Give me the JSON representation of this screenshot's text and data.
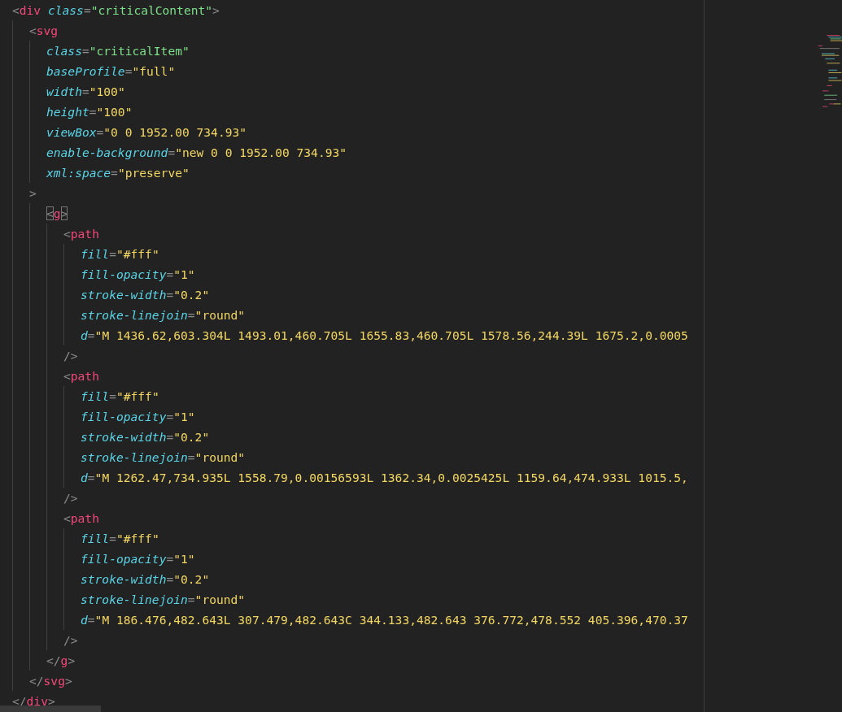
{
  "editor": {
    "lines": [
      {
        "tokens": [
          {
            "kind": "punct",
            "text": "<"
          },
          {
            "kind": "tag",
            "text": "div"
          },
          {
            "kind": "attr",
            "text": "class"
          },
          {
            "kind": "punct",
            "text": "="
          },
          {
            "kind": "class-value",
            "text": "\"criticalContent\""
          },
          {
            "kind": "punct",
            "text": ">"
          }
        ],
        "children": [
          {
            "tokens": [
              {
                "kind": "punct",
                "text": "<"
              },
              {
                "kind": "tag",
                "text": "svg"
              }
            ],
            "children": [
              {
                "tokens": [
                  {
                    "kind": "attr",
                    "text": "class"
                  },
                  {
                    "kind": "punct",
                    "text": "="
                  },
                  {
                    "kind": "class-value",
                    "text": "\"criticalItem\""
                  }
                ]
              },
              {
                "tokens": [
                  {
                    "kind": "attr",
                    "text": "baseProfile"
                  },
                  {
                    "kind": "punct",
                    "text": "="
                  },
                  {
                    "kind": "value",
                    "text": "\"full\""
                  }
                ]
              },
              {
                "tokens": [
                  {
                    "kind": "attr",
                    "text": "width"
                  },
                  {
                    "kind": "punct",
                    "text": "="
                  },
                  {
                    "kind": "value",
                    "text": "\"100\""
                  }
                ]
              },
              {
                "tokens": [
                  {
                    "kind": "attr",
                    "text": "height"
                  },
                  {
                    "kind": "punct",
                    "text": "="
                  },
                  {
                    "kind": "value",
                    "text": "\"100\""
                  }
                ]
              },
              {
                "tokens": [
                  {
                    "kind": "attr",
                    "text": "viewBox"
                  },
                  {
                    "kind": "punct",
                    "text": "="
                  },
                  {
                    "kind": "value",
                    "text": "\"0 0 1952.00 734.93\""
                  }
                ]
              },
              {
                "tokens": [
                  {
                    "kind": "attr",
                    "text": "enable-background"
                  },
                  {
                    "kind": "punct",
                    "text": "="
                  },
                  {
                    "kind": "value",
                    "text": "\"new 0 0 1952.00 734.93\""
                  }
                ]
              },
              {
                "tokens": [
                  {
                    "kind": "attr",
                    "text": "xml:space"
                  },
                  {
                    "kind": "punct",
                    "text": "="
                  },
                  {
                    "kind": "value",
                    "text": "\"preserve\""
                  }
                ]
              }
            ]
          },
          {
            "tokens": [
              {
                "kind": "punct",
                "text": ">"
              }
            ],
            "children": [
              {
                "tokens": [
                  {
                    "kind": "punct",
                    "text": "<",
                    "matched": true
                  },
                  {
                    "kind": "tag",
                    "text": "g"
                  },
                  {
                    "kind": "punct",
                    "text": ">",
                    "matched": true
                  }
                ],
                "children": [
                  {
                    "tokens": [
                      {
                        "kind": "punct",
                        "text": "<"
                      },
                      {
                        "kind": "tag",
                        "text": "path"
                      }
                    ],
                    "children": [
                      {
                        "tokens": [
                          {
                            "kind": "attr",
                            "text": "fill"
                          },
                          {
                            "kind": "punct",
                            "text": "="
                          },
                          {
                            "kind": "value",
                            "text": "\"#fff\""
                          }
                        ]
                      },
                      {
                        "tokens": [
                          {
                            "kind": "attr",
                            "text": "fill-opacity"
                          },
                          {
                            "kind": "punct",
                            "text": "="
                          },
                          {
                            "kind": "value",
                            "text": "\"1\""
                          }
                        ]
                      },
                      {
                        "tokens": [
                          {
                            "kind": "attr",
                            "text": "stroke-width"
                          },
                          {
                            "kind": "punct",
                            "text": "="
                          },
                          {
                            "kind": "value",
                            "text": "\"0.2\""
                          }
                        ]
                      },
                      {
                        "tokens": [
                          {
                            "kind": "attr",
                            "text": "stroke-linejoin"
                          },
                          {
                            "kind": "punct",
                            "text": "="
                          },
                          {
                            "kind": "value",
                            "text": "\"round\""
                          }
                        ]
                      },
                      {
                        "tokens": [
                          {
                            "kind": "attr",
                            "text": "d"
                          },
                          {
                            "kind": "punct",
                            "text": "="
                          },
                          {
                            "kind": "value",
                            "text": "\"M 1436.62,603.304L 1493.01,460.705L 1655.83,460.705L 1578.56,244.39L 1675.2,0.0005"
                          }
                        ]
                      }
                    ]
                  },
                  {
                    "tokens": [
                      {
                        "kind": "punct",
                        "text": "/>"
                      }
                    ]
                  },
                  {
                    "tokens": [
                      {
                        "kind": "punct",
                        "text": "<"
                      },
                      {
                        "kind": "tag",
                        "text": "path"
                      }
                    ],
                    "children": [
                      {
                        "tokens": [
                          {
                            "kind": "attr",
                            "text": "fill"
                          },
                          {
                            "kind": "punct",
                            "text": "="
                          },
                          {
                            "kind": "value",
                            "text": "\"#fff\""
                          }
                        ]
                      },
                      {
                        "tokens": [
                          {
                            "kind": "attr",
                            "text": "fill-opacity"
                          },
                          {
                            "kind": "punct",
                            "text": "="
                          },
                          {
                            "kind": "value",
                            "text": "\"1\""
                          }
                        ]
                      },
                      {
                        "tokens": [
                          {
                            "kind": "attr",
                            "text": "stroke-width"
                          },
                          {
                            "kind": "punct",
                            "text": "="
                          },
                          {
                            "kind": "value",
                            "text": "\"0.2\""
                          }
                        ]
                      },
                      {
                        "tokens": [
                          {
                            "kind": "attr",
                            "text": "stroke-linejoin"
                          },
                          {
                            "kind": "punct",
                            "text": "="
                          },
                          {
                            "kind": "value",
                            "text": "\"round\""
                          }
                        ]
                      },
                      {
                        "tokens": [
                          {
                            "kind": "attr",
                            "text": "d"
                          },
                          {
                            "kind": "punct",
                            "text": "="
                          },
                          {
                            "kind": "value",
                            "text": "\"M 1262.47,734.935L 1558.79,0.00156593L 1362.34,0.0025425L 1159.64,474.933L 1015.5,"
                          }
                        ]
                      }
                    ]
                  },
                  {
                    "tokens": [
                      {
                        "kind": "punct",
                        "text": "/>"
                      }
                    ]
                  },
                  {
                    "tokens": [
                      {
                        "kind": "punct",
                        "text": "<"
                      },
                      {
                        "kind": "tag",
                        "text": "path"
                      }
                    ],
                    "children": [
                      {
                        "tokens": [
                          {
                            "kind": "attr",
                            "text": "fill"
                          },
                          {
                            "kind": "punct",
                            "text": "="
                          },
                          {
                            "kind": "value",
                            "text": "\"#fff\""
                          }
                        ]
                      },
                      {
                        "tokens": [
                          {
                            "kind": "attr",
                            "text": "fill-opacity"
                          },
                          {
                            "kind": "punct",
                            "text": "="
                          },
                          {
                            "kind": "value",
                            "text": "\"1\""
                          }
                        ]
                      },
                      {
                        "tokens": [
                          {
                            "kind": "attr",
                            "text": "stroke-width"
                          },
                          {
                            "kind": "punct",
                            "text": "="
                          },
                          {
                            "kind": "value",
                            "text": "\"0.2\""
                          }
                        ]
                      },
                      {
                        "tokens": [
                          {
                            "kind": "attr",
                            "text": "stroke-linejoin"
                          },
                          {
                            "kind": "punct",
                            "text": "="
                          },
                          {
                            "kind": "value",
                            "text": "\"round\""
                          }
                        ]
                      },
                      {
                        "tokens": [
                          {
                            "kind": "attr",
                            "text": "d"
                          },
                          {
                            "kind": "punct",
                            "text": "="
                          },
                          {
                            "kind": "value",
                            "text": "\"M 186.476,482.643L 307.479,482.643C 344.133,482.643 376.772,478.552 405.396,470.37"
                          }
                        ]
                      }
                    ]
                  },
                  {
                    "tokens": [
                      {
                        "kind": "punct",
                        "text": "/>"
                      }
                    ]
                  }
                ]
              },
              {
                "tokens": [
                  {
                    "kind": "punct",
                    "text": "</"
                  },
                  {
                    "kind": "tag",
                    "text": "g"
                  },
                  {
                    "kind": "punct",
                    "text": ">"
                  }
                ]
              }
            ]
          },
          {
            "tokens": [
              {
                "kind": "punct",
                "text": "</"
              },
              {
                "kind": "tag",
                "text": "svg"
              },
              {
                "kind": "punct",
                "text": ">"
              }
            ]
          }
        ]
      },
      {
        "tokens": [
          {
            "kind": "punct",
            "text": "</"
          },
          {
            "kind": "tag",
            "text": "div"
          },
          {
            "kind": "punct",
            "text": ">"
          }
        ]
      }
    ]
  }
}
